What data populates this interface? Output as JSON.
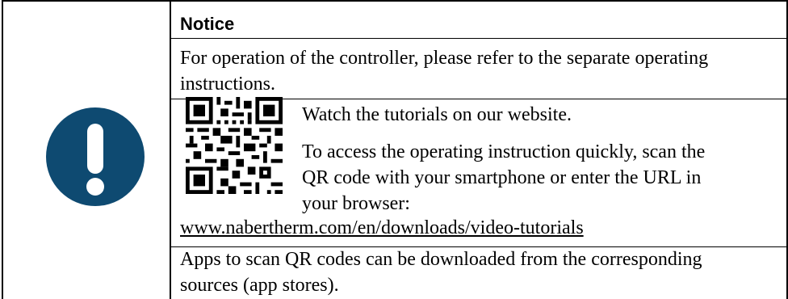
{
  "notice": {
    "title": "Notice",
    "intro_line1": "For operation of the controller, please refer to the separate operating",
    "intro_line2": "instructions.",
    "tutorials": "Watch the tutorials on our website.",
    "access_line1": "To access the operating instruction quickly, scan the",
    "access_line2": "QR code with your smartphone or enter the URL in",
    "access_line3": "your browser:",
    "url": "www.nabertherm.com/en/downloads/video-tutorials",
    "apps_line1": "Apps to scan QR codes can be downloaded from the corresponding",
    "apps_line2": "sources (app stores)."
  },
  "icons": {
    "badge": "exclamation-icon",
    "qr": "qr-code-icon"
  },
  "colors": {
    "badge": "#0e4a71",
    "link": "#1a56c9"
  }
}
